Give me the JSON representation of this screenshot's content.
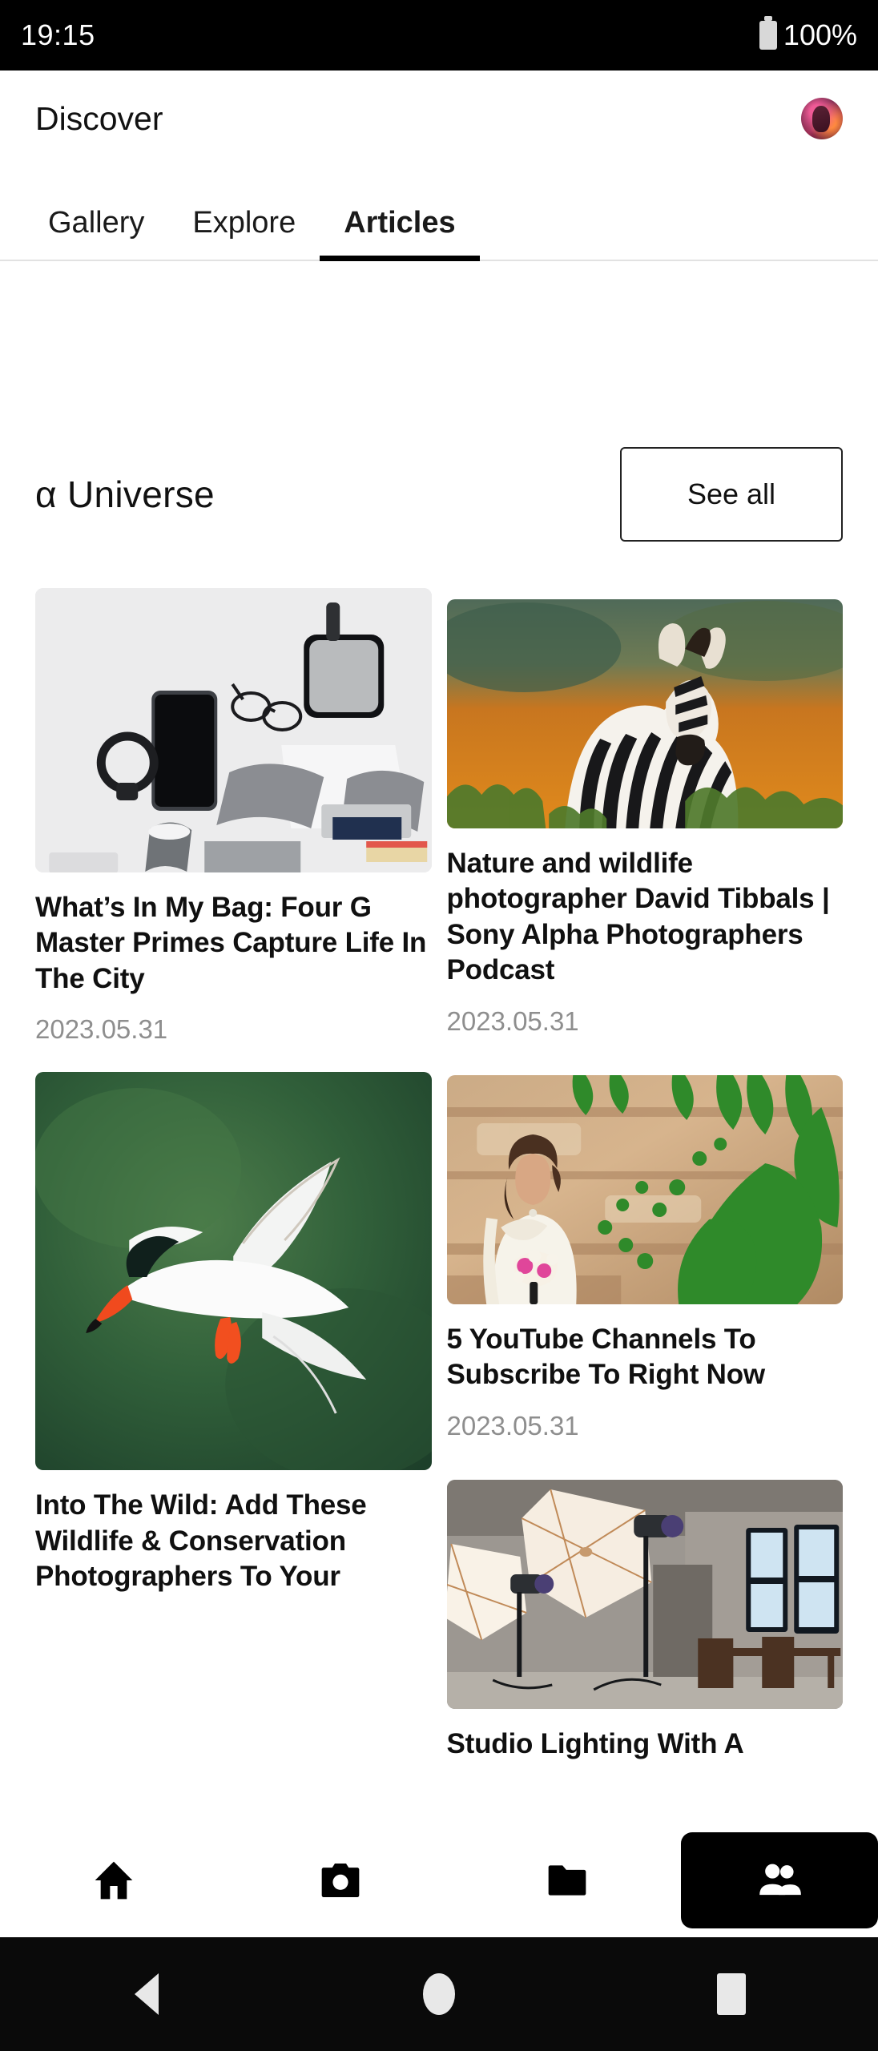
{
  "status_bar": {
    "time": "19:15",
    "battery_text": "100%",
    "battery_icon": "battery-full-icon"
  },
  "header": {
    "title": "Discover",
    "avatar_icon": "user-avatar"
  },
  "tabs": [
    {
      "label": "Gallery",
      "active": false
    },
    {
      "label": "Explore",
      "active": false
    },
    {
      "label": "Articles",
      "active": true
    }
  ],
  "section": {
    "title": "α Universe",
    "see_all_label": "See all"
  },
  "articles": {
    "left_column": [
      {
        "title": "What’s In My Bag: Four G Master Primes Capture Life In The City",
        "date": "2023.05.31",
        "image": "flatlay-gadgets-photo"
      },
      {
        "title": "Into The Wild: Add These Wildlife & Conservation Photographers To Your",
        "date": "",
        "image": "tern-in-flight-photo"
      }
    ],
    "right_column": [
      {
        "title": "Nature and wildlife photographer David Tibbals | Sony Alpha Photographers Podcast",
        "date": "2023.05.31",
        "image": "zebra-savanna-photo"
      },
      {
        "title": "5 YouTube Channels To Subscribe To Right Now",
        "date": "2023.05.31",
        "image": "bride-ivy-wall-photo"
      },
      {
        "title": "Studio Lighting With A",
        "date": "",
        "image": "studio-umbrella-lights-photo"
      }
    ]
  },
  "bottom_nav": [
    {
      "icon": "home-icon",
      "active": false
    },
    {
      "icon": "camera-icon",
      "active": false
    },
    {
      "icon": "folder-icon",
      "active": false
    },
    {
      "icon": "people-icon",
      "active": true
    }
  ],
  "system_nav": [
    {
      "icon": "back-triangle-icon"
    },
    {
      "icon": "home-circle-icon"
    },
    {
      "icon": "recents-square-icon"
    }
  ],
  "colors": {
    "accent": "#000000",
    "background": "#ffffff",
    "muted_text": "#8e8e8e",
    "divider": "#e2e2e2"
  }
}
